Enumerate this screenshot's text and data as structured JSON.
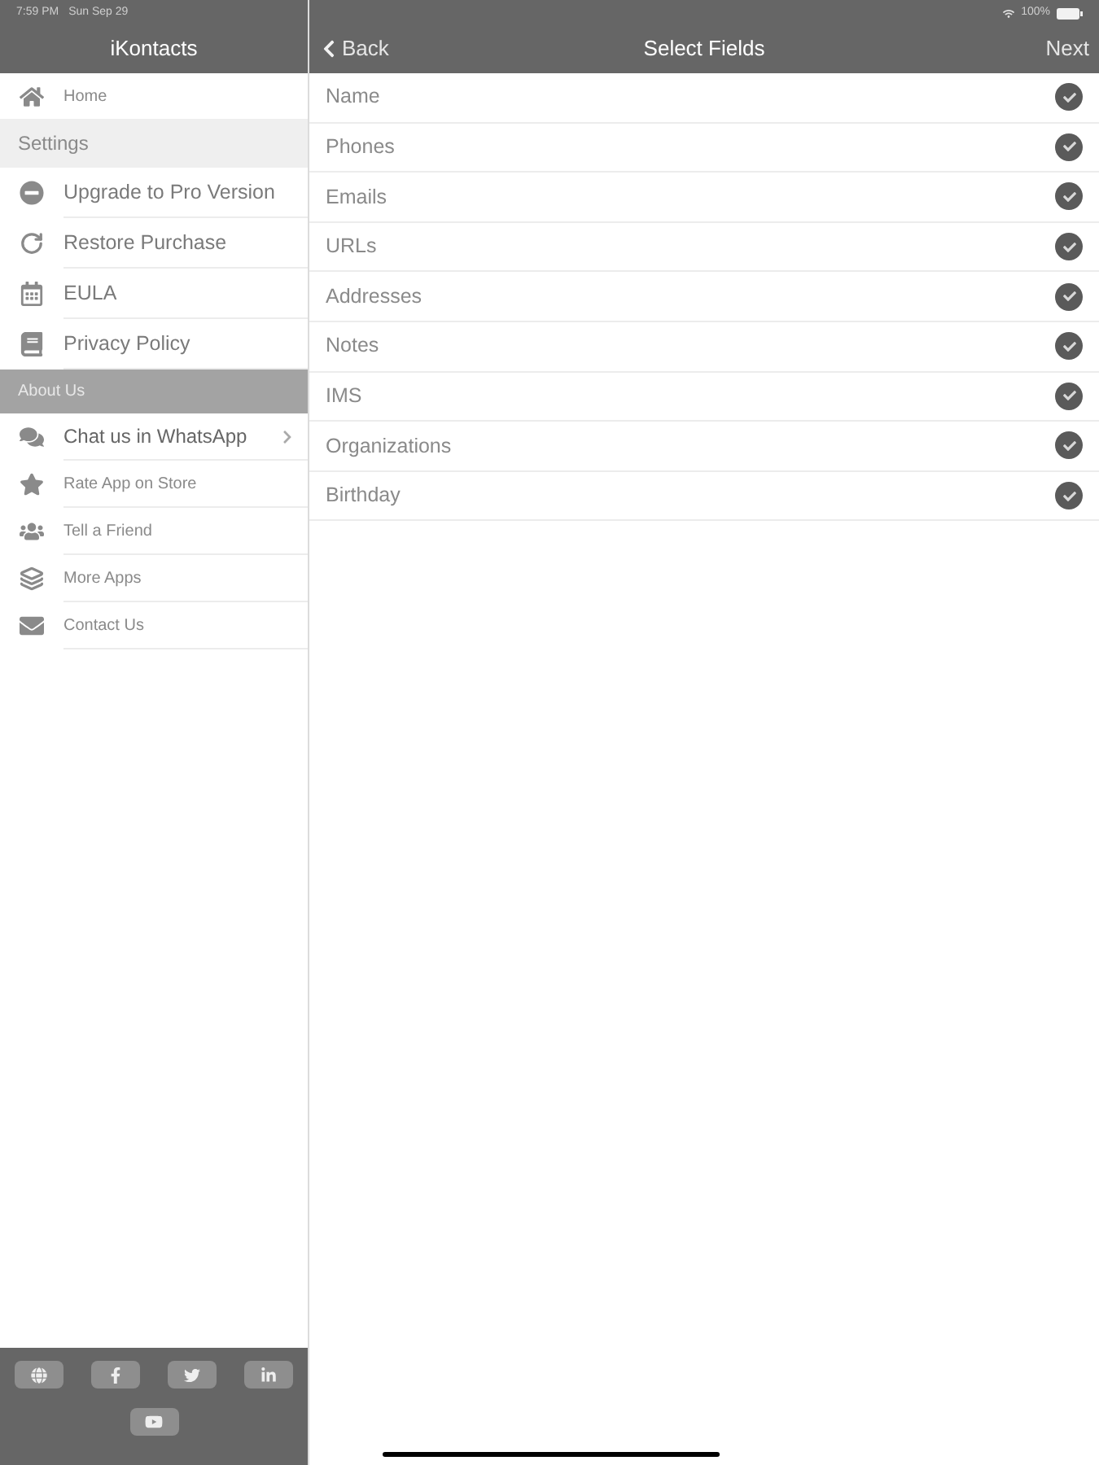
{
  "status_bar": {
    "time": "7:59 PM",
    "date": "Sun Sep 29",
    "battery": "100%"
  },
  "sidebar": {
    "title": "iKontacts",
    "home": {
      "label": "Home"
    },
    "sections": [
      {
        "title": "Settings",
        "highlighted": false,
        "items": [
          {
            "kind": "standard",
            "label": "Upgrade to Pro Version"
          },
          {
            "kind": "standard",
            "label": "Restore Purchase"
          },
          {
            "kind": "standard",
            "label": "EULA"
          },
          {
            "kind": "standard",
            "label": "Privacy Policy"
          }
        ]
      },
      {
        "title": "About Us",
        "highlighted": true,
        "items": [
          {
            "kind": "link",
            "label": "Chat us in WhatsApp"
          },
          {
            "kind": "small",
            "label": "Rate App on Store"
          },
          {
            "kind": "small",
            "label": "Tell a Friend"
          },
          {
            "kind": "small",
            "label": "More Apps"
          },
          {
            "kind": "small",
            "label": "Contact Us"
          }
        ]
      }
    ]
  },
  "nav_bar": {
    "back": "Back",
    "title": "Select Fields",
    "next": "Next"
  },
  "fields": [
    {
      "label": "Name",
      "checked": true
    },
    {
      "label": "Phones",
      "checked": true
    },
    {
      "label": "Emails",
      "checked": true
    },
    {
      "label": "URLs",
      "checked": true
    },
    {
      "label": "Addresses",
      "checked": true
    },
    {
      "label": "Notes",
      "checked": true
    },
    {
      "label": "IMS",
      "checked": true
    },
    {
      "label": "Organizations",
      "checked": true
    },
    {
      "label": "Birthday",
      "checked": true
    }
  ]
}
